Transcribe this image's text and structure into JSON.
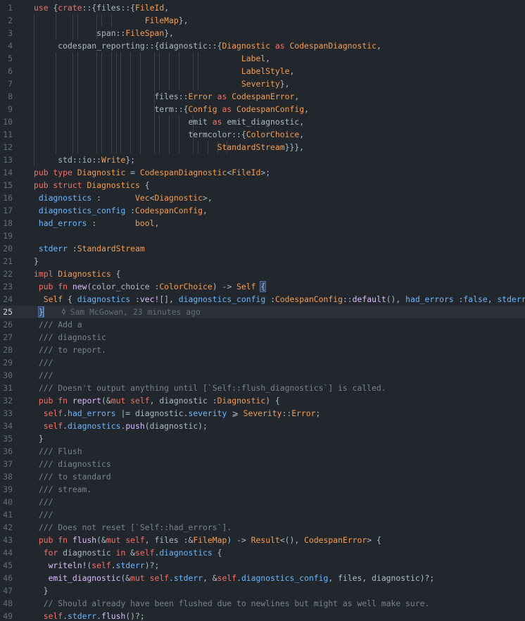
{
  "editor": {
    "current_line": 25,
    "blame": {
      "text": "Sam McGowan, 23 minutes ago",
      "icon": "git-commit-icon"
    },
    "colors": {
      "background": "#22272e",
      "keyword": "#f47067",
      "type": "#f69d50",
      "function": "#dcbdfb",
      "property": "#6cb6ff",
      "comment": "#768390",
      "text": "#adbac7",
      "line_number": "#636e7b"
    }
  },
  "lines": [
    {
      "n": "1",
      "g": [],
      "seg": [
        [
          "use ",
          "kw"
        ],
        [
          "{",
          ""
        ],
        [
          "crate",
          "kw"
        ],
        [
          "::{",
          ""
        ],
        [
          "files",
          "pn"
        ],
        [
          "::{",
          ""
        ],
        [
          "FileId",
          "ty"
        ],
        [
          ",",
          ""
        ]
      ]
    },
    {
      "n": "2",
      "g": [
        0,
        1,
        2,
        3,
        4,
        5,
        6
      ],
      "seg": [
        [
          "                       FileMap",
          "ty"
        ],
        [
          "},",
          ""
        ]
      ]
    },
    {
      "n": "3",
      "g": [
        0,
        1,
        2,
        3,
        4
      ],
      "seg": [
        [
          "             span",
          "pn"
        ],
        [
          "::",
          ""
        ],
        [
          "FileSpan",
          "ty"
        ],
        [
          "},",
          ""
        ]
      ]
    },
    {
      "n": "4",
      "g": [
        0
      ],
      "seg": [
        [
          "     codespan_reporting",
          "pn"
        ],
        [
          "::{",
          ""
        ],
        [
          "diagnostic",
          "pn"
        ],
        [
          "::{",
          ""
        ],
        [
          "Diagnostic",
          "ty"
        ],
        [
          " as ",
          "kw"
        ],
        [
          "CodespanDiagnostic",
          "ty"
        ],
        [
          ",",
          ""
        ]
      ]
    },
    {
      "n": "5",
      "g": [
        0,
        1,
        2,
        3,
        4,
        5,
        6,
        7,
        8,
        9,
        10,
        11,
        12,
        13,
        14,
        15,
        16
      ],
      "seg": [
        [
          "                                           Label",
          "ty"
        ],
        [
          ",",
          ""
        ]
      ]
    },
    {
      "n": "6",
      "g": [
        0,
        1,
        2,
        3,
        4,
        5,
        6,
        7,
        8,
        9,
        10,
        11,
        12,
        13,
        14,
        15,
        16
      ],
      "seg": [
        [
          "                                           LabelStyle",
          "ty"
        ],
        [
          ",",
          ""
        ]
      ]
    },
    {
      "n": "7",
      "g": [
        0,
        1,
        2,
        3,
        4,
        5,
        6,
        7,
        8,
        9,
        10,
        11,
        12,
        13,
        14,
        15,
        16
      ],
      "seg": [
        [
          "                                           Severity",
          "ty"
        ],
        [
          "},",
          ""
        ]
      ]
    },
    {
      "n": "8",
      "g": [
        0,
        1,
        2,
        3,
        4,
        5,
        6,
        7,
        8,
        9,
        10,
        11
      ],
      "seg": [
        [
          "                         files",
          "pn"
        ],
        [
          "::",
          ""
        ],
        [
          "Error",
          "ty"
        ],
        [
          " as ",
          "kw"
        ],
        [
          "CodespanError",
          "ty"
        ],
        [
          ",",
          ""
        ]
      ]
    },
    {
      "n": "9",
      "g": [
        0,
        1,
        2,
        3,
        4,
        5,
        6,
        7,
        8,
        9,
        10,
        11
      ],
      "seg": [
        [
          "                         term",
          "pn"
        ],
        [
          "::{",
          ""
        ],
        [
          "Config",
          "ty"
        ],
        [
          " as ",
          "kw"
        ],
        [
          "CodespanConfig",
          "ty"
        ],
        [
          ",",
          ""
        ]
      ]
    },
    {
      "n": "10",
      "g": [
        0,
        1,
        2,
        3,
        4,
        5,
        6,
        7,
        8,
        9,
        10,
        11,
        12,
        13,
        14,
        15
      ],
      "seg": [
        [
          "                                emit ",
          ""
        ],
        [
          "as",
          "kw"
        ],
        [
          " emit_diagnostic,",
          ""
        ]
      ]
    },
    {
      "n": "11",
      "g": [
        0,
        1,
        2,
        3,
        4,
        5,
        6,
        7,
        8,
        9,
        10,
        11,
        12,
        13,
        14,
        15
      ],
      "seg": [
        [
          "                                termcolor",
          "pn"
        ],
        [
          "::{",
          ""
        ],
        [
          "ColorChoice",
          "ty"
        ],
        [
          ",",
          ""
        ]
      ]
    },
    {
      "n": "12",
      "g": [
        0,
        1,
        2,
        3,
        4,
        5,
        6,
        7,
        8,
        9,
        10,
        11,
        12,
        13,
        14,
        15,
        16,
        17,
        18,
        19
      ],
      "seg": [
        [
          "                                      StandardStream",
          "ty"
        ],
        [
          "}}},",
          ""
        ]
      ]
    },
    {
      "n": "13",
      "g": [
        0
      ],
      "seg": [
        [
          "     std",
          "pn"
        ],
        [
          "::",
          ""
        ],
        [
          "io",
          "pn"
        ],
        [
          "::",
          ""
        ],
        [
          "Write",
          "ty"
        ],
        [
          "};",
          ""
        ]
      ]
    },
    {
      "n": "14",
      "g": [],
      "seg": [
        [
          "pub type ",
          "kw"
        ],
        [
          "Diagnostic",
          "ty"
        ],
        [
          " = ",
          ""
        ],
        [
          "CodespanDiagnostic",
          "ty"
        ],
        [
          "<",
          ""
        ],
        [
          "FileId",
          "ty"
        ],
        [
          ">;",
          ""
        ]
      ]
    },
    {
      "n": "15",
      "g": [],
      "seg": [
        [
          "pub struct ",
          "kw"
        ],
        [
          "Diagnostics",
          "ty"
        ],
        [
          " {",
          ""
        ]
      ]
    },
    {
      "n": "16",
      "g": [],
      "seg": [
        [
          " diagnostics",
          "pr"
        ],
        [
          " :       ",
          ""
        ],
        [
          "Vec",
          "ty"
        ],
        [
          "<",
          ""
        ],
        [
          "Diagnostic",
          "ty"
        ],
        [
          ">,",
          ""
        ]
      ]
    },
    {
      "n": "17",
      "g": [],
      "seg": [
        [
          " diagnostics_config",
          "pr"
        ],
        [
          " :",
          ""
        ],
        [
          "CodespanConfig",
          "ty"
        ],
        [
          ",",
          ""
        ]
      ]
    },
    {
      "n": "18",
      "g": [],
      "seg": [
        [
          " had_errors",
          "pr"
        ],
        [
          " :        ",
          ""
        ],
        [
          "bool",
          "ty"
        ],
        [
          ",",
          ""
        ]
      ]
    },
    {
      "n": "19",
      "g": [],
      "seg": []
    },
    {
      "n": "20",
      "g": [],
      "seg": [
        [
          " stderr",
          "pr"
        ],
        [
          " :",
          ""
        ],
        [
          "StandardStream",
          "ty"
        ]
      ]
    },
    {
      "n": "21",
      "g": [],
      "seg": [
        [
          "}",
          ""
        ]
      ]
    },
    {
      "n": "22",
      "g": [],
      "seg": [
        [
          "impl ",
          "kw"
        ],
        [
          "Diagnostics",
          "ty"
        ],
        [
          " {",
          ""
        ]
      ]
    },
    {
      "n": "23",
      "g": [],
      "seg": [
        [
          " pub fn ",
          "kw"
        ],
        [
          "new",
          "fn"
        ],
        [
          "(color_choice :",
          ""
        ],
        [
          "ColorChoice",
          "ty"
        ],
        [
          ") -> ",
          ""
        ],
        [
          "Self",
          "ty"
        ],
        [
          " ",
          ""
        ],
        [
          "{",
          "br"
        ]
      ]
    },
    {
      "n": "24",
      "g": [],
      "seg": [
        [
          "  Self",
          "ty"
        ],
        [
          " { ",
          ""
        ],
        [
          "diagnostics",
          "pr"
        ],
        [
          " :",
          ""
        ],
        [
          "vec!",
          "fn"
        ],
        [
          "[], ",
          ""
        ],
        [
          "diagnostics_config",
          "pr"
        ],
        [
          " :",
          ""
        ],
        [
          "CodespanConfig",
          "ty"
        ],
        [
          "::",
          ""
        ],
        [
          "default",
          "fn"
        ],
        [
          "(), ",
          ""
        ],
        [
          "had_errors",
          "pr"
        ],
        [
          " :",
          ""
        ],
        [
          "false",
          "pr"
        ],
        [
          ", ",
          ""
        ],
        [
          "stderr",
          "pr"
        ],
        [
          " :",
          ""
        ],
        [
          "St",
          "ty"
        ]
      ]
    },
    {
      "n": "25",
      "g": [],
      "seg": [
        [
          " ",
          ""
        ],
        [
          "}",
          "br"
        ]
      ],
      "blame": true
    },
    {
      "n": "26",
      "g": [],
      "seg": [
        [
          " /// Add a",
          "cm"
        ]
      ]
    },
    {
      "n": "27",
      "g": [],
      "seg": [
        [
          " /// diagnostic",
          "cm"
        ]
      ]
    },
    {
      "n": "28",
      "g": [],
      "seg": [
        [
          " /// to report.",
          "cm"
        ]
      ]
    },
    {
      "n": "29",
      "g": [],
      "seg": [
        [
          " ///",
          "cm"
        ]
      ]
    },
    {
      "n": "30",
      "g": [],
      "seg": [
        [
          " ///",
          "cm"
        ]
      ]
    },
    {
      "n": "31",
      "g": [],
      "seg": [
        [
          " /// Doesn't output anything until [`Self::flush_diagnostics`] is called.",
          "cm"
        ]
      ]
    },
    {
      "n": "32",
      "g": [],
      "seg": [
        [
          " pub fn ",
          "kw"
        ],
        [
          "report",
          "fn"
        ],
        [
          "(&",
          ""
        ],
        [
          "mut self",
          "kw"
        ],
        [
          ", diagnostic :",
          ""
        ],
        [
          "Diagnostic",
          "ty"
        ],
        [
          ") {",
          ""
        ]
      ]
    },
    {
      "n": "33",
      "g": [],
      "seg": [
        [
          "  self",
          "kw"
        ],
        [
          ".",
          ""
        ],
        [
          "had_errors",
          "pr"
        ],
        [
          " |= diagnostic.",
          ""
        ],
        [
          "severity",
          "pr"
        ],
        [
          " ⩾ ",
          ""
        ],
        [
          "Severity",
          "ty"
        ],
        [
          "::",
          ""
        ],
        [
          "Error",
          "ty"
        ],
        [
          ";",
          ""
        ]
      ]
    },
    {
      "n": "34",
      "g": [],
      "seg": [
        [
          "  self",
          "kw"
        ],
        [
          ".",
          ""
        ],
        [
          "diagnostics",
          "pr"
        ],
        [
          ".",
          ""
        ],
        [
          "push",
          "fn"
        ],
        [
          "(diagnostic);",
          ""
        ]
      ]
    },
    {
      "n": "35",
      "g": [],
      "seg": [
        [
          " }",
          ""
        ]
      ]
    },
    {
      "n": "36",
      "g": [],
      "seg": [
        [
          " /// Flush",
          "cm"
        ]
      ]
    },
    {
      "n": "37",
      "g": [],
      "seg": [
        [
          " /// diagnostics",
          "cm"
        ]
      ]
    },
    {
      "n": "38",
      "g": [],
      "seg": [
        [
          " /// to standard",
          "cm"
        ]
      ]
    },
    {
      "n": "39",
      "g": [],
      "seg": [
        [
          " /// stream.",
          "cm"
        ]
      ]
    },
    {
      "n": "40",
      "g": [],
      "seg": [
        [
          " ///",
          "cm"
        ]
      ]
    },
    {
      "n": "41",
      "g": [],
      "seg": [
        [
          " ///",
          "cm"
        ]
      ]
    },
    {
      "n": "42",
      "g": [],
      "seg": [
        [
          " /// Does not reset [`Self::had_errors`].",
          "cm"
        ]
      ]
    },
    {
      "n": "43",
      "g": [],
      "seg": [
        [
          " pub fn ",
          "kw"
        ],
        [
          "flush",
          "fn"
        ],
        [
          "(&",
          ""
        ],
        [
          "mut self",
          "kw"
        ],
        [
          ", files :&",
          ""
        ],
        [
          "FileMap",
          "ty"
        ],
        [
          ") -> ",
          ""
        ],
        [
          "Result",
          "ty"
        ],
        [
          "<(), ",
          ""
        ],
        [
          "CodespanError",
          "ty"
        ],
        [
          "> {",
          ""
        ]
      ]
    },
    {
      "n": "44",
      "g": [],
      "seg": [
        [
          "  for",
          "kw"
        ],
        [
          " diagnostic ",
          ""
        ],
        [
          "in",
          "kw"
        ],
        [
          " &",
          ""
        ],
        [
          "self",
          "kw"
        ],
        [
          ".",
          ""
        ],
        [
          "diagnostics",
          "pr"
        ],
        [
          " {",
          ""
        ]
      ]
    },
    {
      "n": "45",
      "g": [],
      "seg": [
        [
          "   writeln!",
          "fn"
        ],
        [
          "(",
          ""
        ],
        [
          "self",
          "kw"
        ],
        [
          ".",
          ""
        ],
        [
          "stderr",
          "pr"
        ],
        [
          ")?;",
          ""
        ]
      ]
    },
    {
      "n": "46",
      "g": [],
      "seg": [
        [
          "   emit_diagnostic",
          "fn"
        ],
        [
          "(&",
          ""
        ],
        [
          "mut self",
          "kw"
        ],
        [
          ".",
          ""
        ],
        [
          "stderr",
          "pr"
        ],
        [
          ", &",
          ""
        ],
        [
          "self",
          "kw"
        ],
        [
          ".",
          ""
        ],
        [
          "diagnostics_config",
          "pr"
        ],
        [
          ", files, diagnostic)?;",
          ""
        ]
      ]
    },
    {
      "n": "47",
      "g": [],
      "seg": [
        [
          "  }",
          ""
        ]
      ]
    },
    {
      "n": "48",
      "g": [],
      "seg": [
        [
          "  // Should already have been flushed due to newlines but might as well make sure.",
          "cm"
        ]
      ]
    },
    {
      "n": "49",
      "g": [],
      "seg": [
        [
          "  self",
          "kw"
        ],
        [
          ".",
          ""
        ],
        [
          "stderr",
          "pr"
        ],
        [
          ".",
          ""
        ],
        [
          "flush",
          "fn"
        ],
        [
          "()?;",
          ""
        ]
      ]
    }
  ]
}
